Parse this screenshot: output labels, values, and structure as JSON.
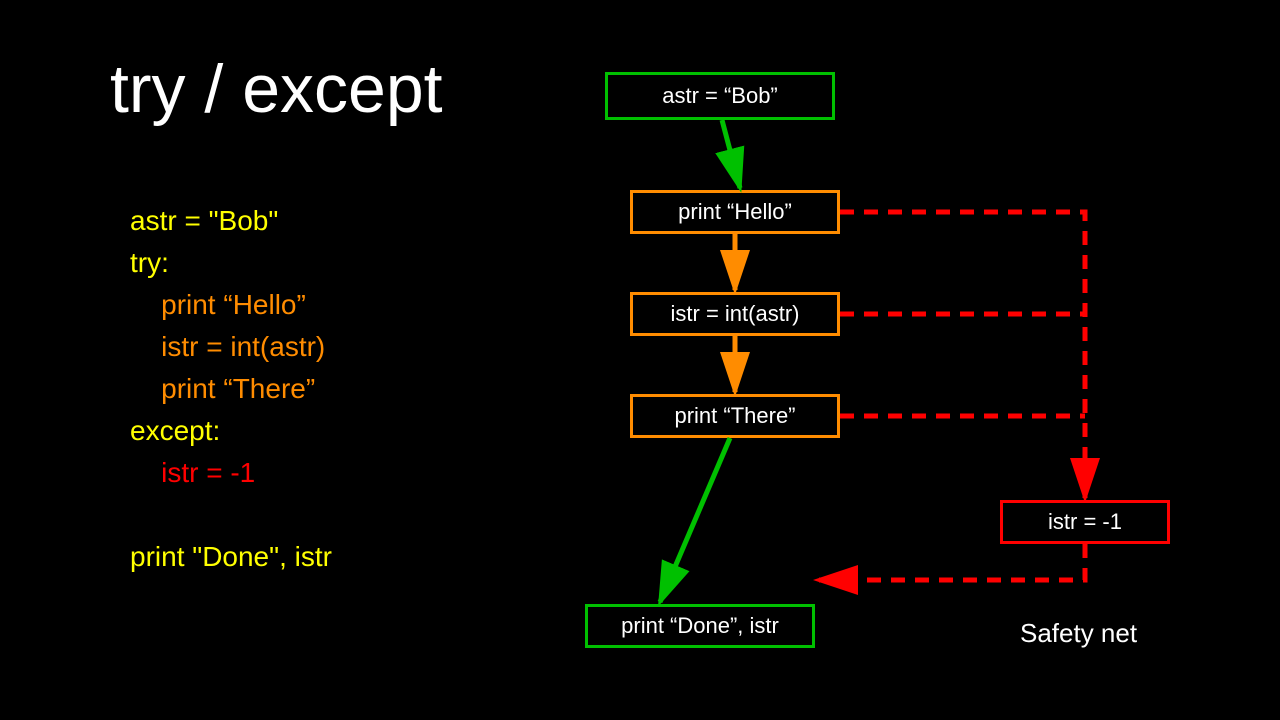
{
  "title": "try / except",
  "code": {
    "l1": "astr = \"Bob\"",
    "l2": "try:",
    "l3": "    print “Hello”",
    "l4": "    istr = int(astr)",
    "l5": "    print “There”",
    "l6": "except:",
    "l7": "    istr = -1",
    "l8": "print \"Done\", istr"
  },
  "flow": {
    "box1": "astr = “Bob”",
    "box2": "print “Hello”",
    "box3": "istr = int(astr)",
    "box4": "print “There”",
    "box5": "print “Done”, istr",
    "box6": "istr = -1"
  },
  "label": "Safety net",
  "colors": {
    "green": "#00c000",
    "orange": "#ff8c00",
    "red": "#ff0000",
    "yellow": "#ffff00"
  }
}
